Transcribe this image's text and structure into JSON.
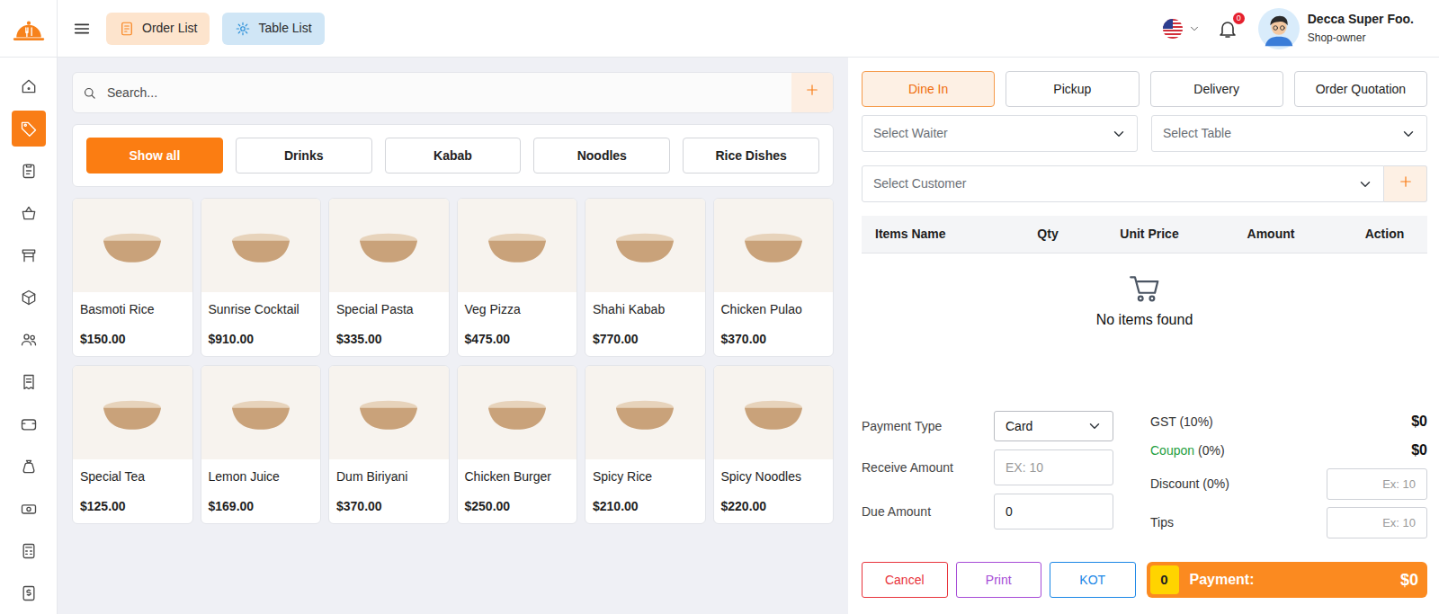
{
  "topbar": {
    "buttons": [
      {
        "label": "Order List",
        "kind": "orders",
        "color": "#f7821b"
      },
      {
        "label": "Table List",
        "kind": "tables",
        "color": "#2b8fd8"
      }
    ],
    "notifications": "0",
    "user": {
      "name": "Decca Super Foo.",
      "role": "Shop-owner"
    }
  },
  "sidebar": {
    "items": [
      {
        "selected": false
      },
      {
        "selected": true
      },
      {
        "selected": false
      },
      {
        "selected": false
      },
      {
        "selected": false
      },
      {
        "selected": false
      },
      {
        "selected": false
      },
      {
        "selected": false
      },
      {
        "selected": false
      },
      {
        "selected": false
      },
      {
        "selected": false
      },
      {
        "selected": false
      },
      {
        "selected": false
      }
    ]
  },
  "search": {
    "placeholder": "Search..."
  },
  "categories": [
    {
      "label": "Show all",
      "selected": true
    },
    {
      "label": "Drinks",
      "selected": false
    },
    {
      "label": "Kabab",
      "selected": false
    },
    {
      "label": "Noodles",
      "selected": false
    },
    {
      "label": "Rice Dishes",
      "selected": false
    }
  ],
  "products": [
    {
      "name": "Basmoti Rice",
      "price": "$150.00"
    },
    {
      "name": "Sunrise Cocktail",
      "price": "$910.00"
    },
    {
      "name": "Special Pasta",
      "price": "$335.00"
    },
    {
      "name": "Veg Pizza",
      "price": "$475.00"
    },
    {
      "name": "Shahi Kabab",
      "price": "$770.00"
    },
    {
      "name": "Chicken Pulao",
      "price": "$370.00"
    },
    {
      "name": "Special Tea",
      "price": "$125.00"
    },
    {
      "name": "Lemon Juice",
      "price": "$169.00"
    },
    {
      "name": "Dum Biriyani",
      "price": "$370.00"
    },
    {
      "name": "Chicken Burger",
      "price": "$250.00"
    },
    {
      "name": "Spicy Rice",
      "price": "$210.00"
    },
    {
      "name": "Spicy Noodles",
      "price": "$220.00"
    }
  ],
  "order_types": [
    {
      "label": "Dine In",
      "selected": true
    },
    {
      "label": "Pickup",
      "selected": false
    },
    {
      "label": "Delivery",
      "selected": false
    },
    {
      "label": "Order Quotation",
      "selected": false
    }
  ],
  "selects": {
    "waiter": "Select Waiter",
    "table": "Select Table",
    "customer": "Select Customer"
  },
  "cart": {
    "columns": [
      "Items Name",
      "Qty",
      "Unit Price",
      "Amount",
      "Action"
    ],
    "empty_text": "No items found"
  },
  "payment": {
    "type_label": "Payment Type",
    "type_value": "Card",
    "receive_label": "Receive Amount",
    "receive_placeholder": "EX: 10",
    "due_label": "Due Amount",
    "due_value": "0"
  },
  "summary": {
    "gst_label": "GST (10%)",
    "gst_value": "$0",
    "coupon_label": "Coupon",
    "coupon_rate": "(0%)",
    "coupon_value": "$0",
    "discount_label": "Discount (0%)",
    "discount_placeholder": "Ex: 10",
    "tips_label": "Tips",
    "tips_placeholder": "Ex: 10"
  },
  "actions": [
    {
      "label": "Cancel",
      "kind": "danger"
    },
    {
      "label": "Print",
      "kind": "purple"
    },
    {
      "label": "KOT",
      "kind": "info"
    }
  ],
  "pay_button": {
    "count": "0",
    "label": "Payment:",
    "total": "$0"
  }
}
